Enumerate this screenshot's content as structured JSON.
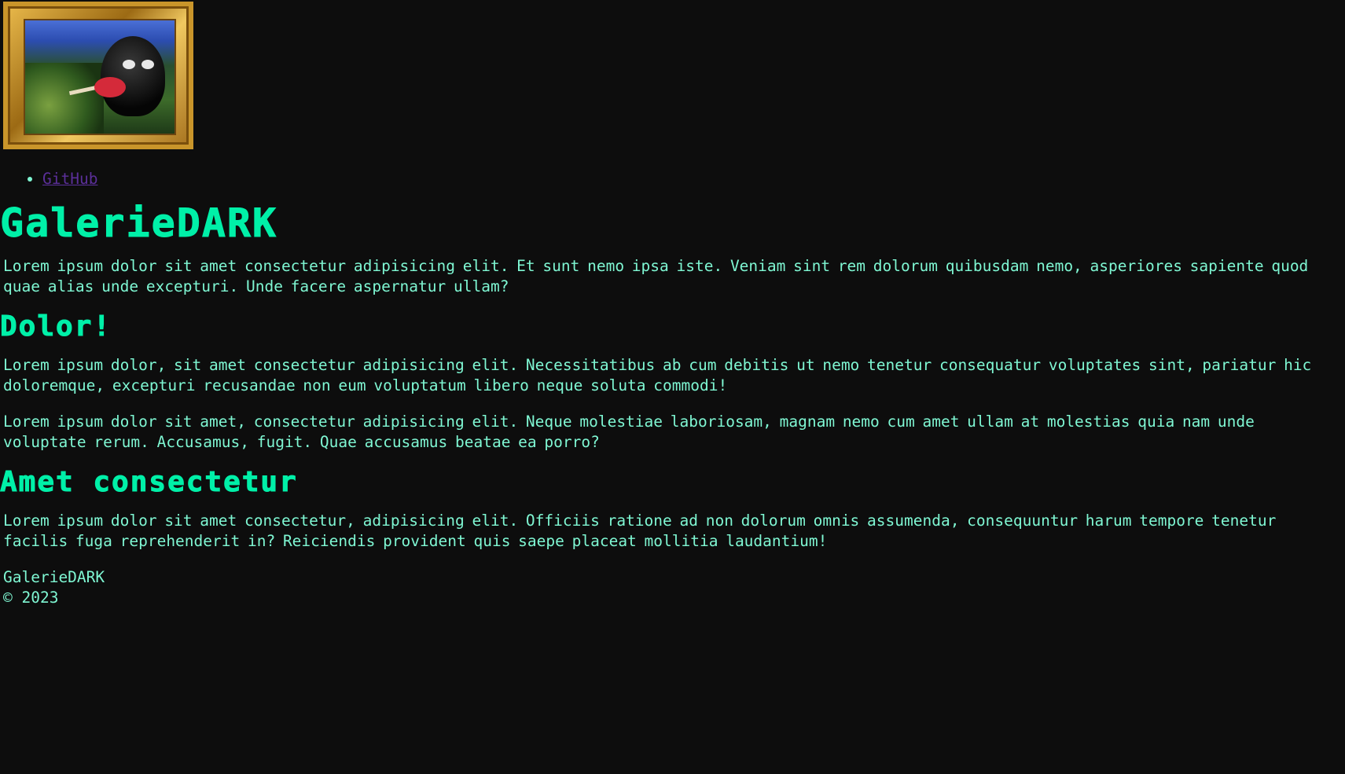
{
  "nav": {
    "links": [
      {
        "label": "GitHub"
      }
    ]
  },
  "main": {
    "title": "GalerieDARK",
    "intro": "Lorem ipsum dolor sit amet consectetur adipisicing elit. Et sunt nemo ipsa iste. Veniam sint rem dolorum quibusdam nemo, asperiores sapiente quod quae alias unde excepturi. Unde facere aspernatur ullam?",
    "section1": {
      "heading": "Dolor!",
      "para1": "Lorem ipsum dolor, sit amet consectetur adipisicing elit. Necessitatibus ab cum debitis ut nemo tenetur consequatur voluptates sint, pariatur hic doloremque, excepturi recusandae non eum voluptatum libero neque soluta commodi!",
      "para2": "Lorem ipsum dolor sit amet, consectetur adipisicing elit. Neque molestiae laboriosam, magnam nemo cum amet ullam at molestias quia nam unde voluptate rerum. Accusamus, fugit. Quae accusamus beatae ea porro?"
    },
    "section2": {
      "heading": "Amet consectetur",
      "para1": "Lorem ipsum dolor sit amet consectetur, adipisicing elit. Officiis ratione ad non dolorum omnis assumenda, consequuntur harum tempore tenetur facilis fuga reprehenderit in? Reiciendis provident quis saepe placeat mollitia laudantium!"
    }
  },
  "footer": {
    "brand": "GalerieDARK",
    "copyright": "© 2023"
  },
  "colors": {
    "background": "#0d0d0d",
    "heading": "#00f0a8",
    "text": "#7ff7d3",
    "link": "#5b2f9a",
    "frame": "#c9952a"
  }
}
